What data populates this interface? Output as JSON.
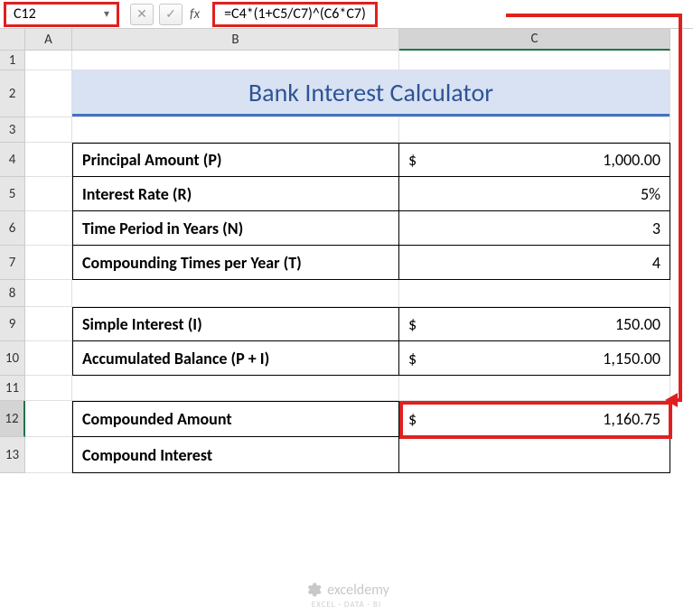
{
  "name_box": "C12",
  "formula": "=C4*(1+C5/C7)^(C6*C7)",
  "fx_label": "fx",
  "cols": {
    "A": "A",
    "B": "B",
    "C": "C"
  },
  "rows": {
    "r1": "1",
    "r2": "2",
    "r3": "3",
    "r4": "4",
    "r5": "5",
    "r6": "6",
    "r7": "7",
    "r8": "8",
    "r9": "9",
    "r10": "10",
    "r11": "11",
    "r12": "12",
    "r13": "13"
  },
  "title": "Bank Interest Calculator",
  "labels": {
    "principal": "Principal Amount (P)",
    "rate": "Interest Rate (R)",
    "years": "Time Period in Years (N)",
    "compounding": "Compounding Times per Year (T)",
    "simple_interest": "Simple Interest (I)",
    "accumulated": "Accumulated Balance (P + I)",
    "compounded": "Compounded Amount",
    "compound_interest": "Compound Interest"
  },
  "values": {
    "principal_sym": "$",
    "principal": "1,000.00",
    "rate": "5%",
    "years": "3",
    "compounding": "4",
    "si_sym": "$",
    "si": "150.00",
    "acc_sym": "$",
    "acc": "1,150.00",
    "ca_sym": "$",
    "ca": "1,160.75"
  },
  "watermark": {
    "text": "exceldemy",
    "sub": "EXCEL · DATA · BI"
  },
  "chart_data": {
    "type": "table",
    "title": "Bank Interest Calculator",
    "rows": [
      {
        "label": "Principal Amount (P)",
        "value": 1000.0,
        "format": "currency"
      },
      {
        "label": "Interest Rate (R)",
        "value": 0.05,
        "format": "percent"
      },
      {
        "label": "Time Period in Years (N)",
        "value": 3
      },
      {
        "label": "Compounding Times per Year (T)",
        "value": 4
      },
      {
        "label": "Simple Interest (I)",
        "value": 150.0,
        "format": "currency"
      },
      {
        "label": "Accumulated Balance (P + I)",
        "value": 1150.0,
        "format": "currency"
      },
      {
        "label": "Compounded Amount",
        "value": 1160.75,
        "format": "currency"
      },
      {
        "label": "Compound Interest",
        "value": null
      }
    ],
    "selected_cell": "C12",
    "formula": "=C4*(1+C5/C7)^(C6*C7)"
  }
}
